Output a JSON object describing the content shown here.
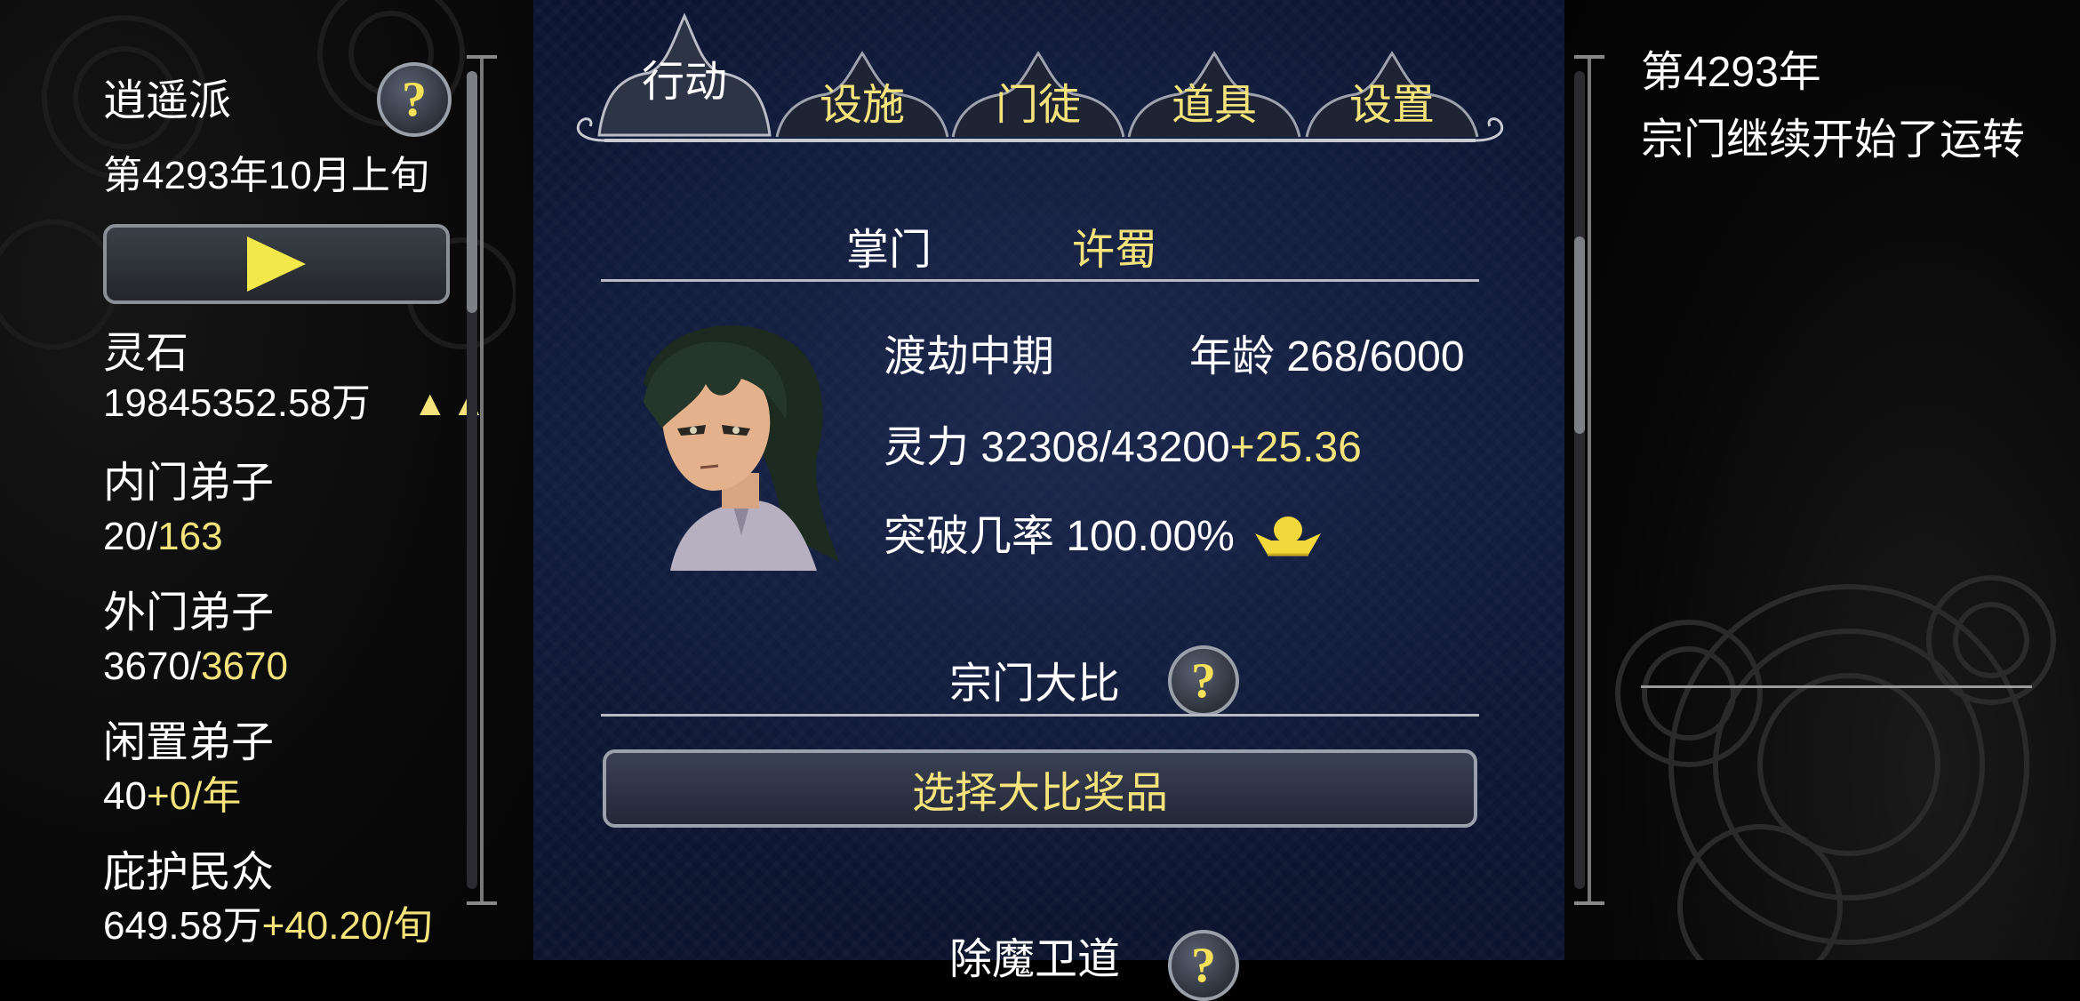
{
  "sidebar": {
    "sect_name": "逍遥派",
    "date": "第4293年10月上旬",
    "help_symbol": "?",
    "stats": [
      {
        "label": "灵石",
        "value": "19845352.58万",
        "extra": "",
        "indicator": "▲▲"
      },
      {
        "label": "内门弟子",
        "value": "20/",
        "extra": "163",
        "indicator": ""
      },
      {
        "label": "外门弟子",
        "value": "3670/",
        "extra": "3670",
        "indicator": ""
      },
      {
        "label": "闲置弟子",
        "value": "40",
        "extra": "+0/年",
        "indicator": ""
      },
      {
        "label": "庇护民众",
        "value": "649.58万",
        "extra": "+40.20/旬",
        "indicator": ""
      }
    ]
  },
  "tabs": [
    {
      "label": "行动",
      "active": true
    },
    {
      "label": "设施",
      "active": false
    },
    {
      "label": "门徒",
      "active": false
    },
    {
      "label": "道具",
      "active": false
    },
    {
      "label": "设置",
      "active": false
    }
  ],
  "leader": {
    "title_label": "掌门",
    "name": "许蜀",
    "realm": "渡劫中期",
    "age_label": "年龄",
    "age_value": "268/6000",
    "spirit_label": "灵力",
    "spirit_value": "32308/43200",
    "spirit_rate": "+25.36",
    "breakthrough_label": "突破几率",
    "breakthrough_value": "100.00%"
  },
  "tournament": {
    "title": "宗门大比",
    "help_symbol": "?",
    "button_label": "选择大比奖品"
  },
  "next_section": {
    "title": "除魔卫道",
    "help_symbol": "?"
  },
  "log": {
    "year": "第4293年",
    "message": "宗门继续开始了运转"
  },
  "colors": {
    "highlight": "#f3e37a",
    "text": "#ffffff",
    "center_bg": "#111b3b"
  }
}
